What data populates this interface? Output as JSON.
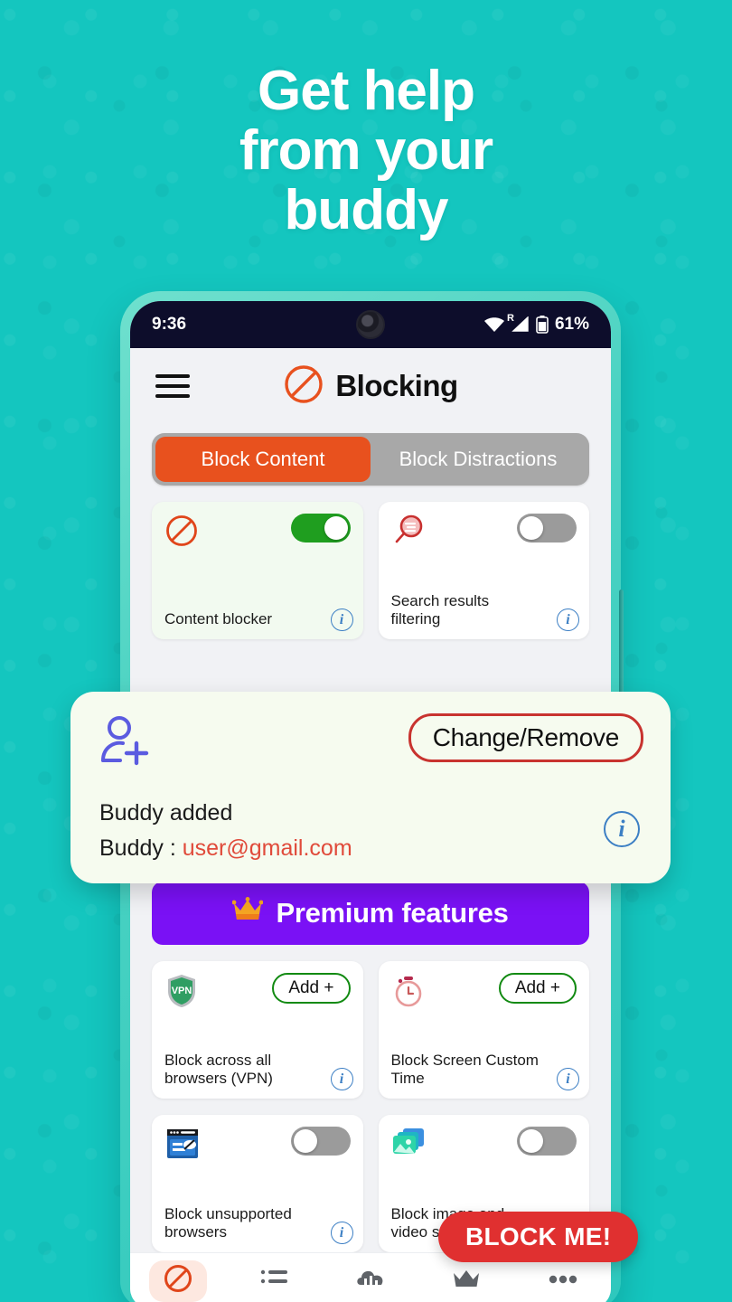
{
  "theme": {
    "background": "#14c6bf",
    "phone_frame": "#4ad2c2",
    "accent_orange": "#e8511e",
    "premium_purple": "#7a11f5",
    "danger_red": "#e03030",
    "toggle_on_green": "#1f9e1f",
    "info_blue": "#3c7fc4",
    "buddy_card_bg": "#f6fbef",
    "email_red": "#e04a3a"
  },
  "headline": {
    "line1": "Get help",
    "line2": "from your",
    "line3": "buddy"
  },
  "status_bar": {
    "time": "9:36",
    "battery_pct": "61%",
    "icons": [
      "wifi-icon",
      "roaming-signal-icon",
      "battery-icon"
    ]
  },
  "app_header": {
    "menu_icon": "hamburger-menu-icon",
    "brand_icon": "no-entry-icon",
    "title": "Blocking"
  },
  "segmented": {
    "tabs": [
      {
        "label": "Block Content",
        "active": true
      },
      {
        "label": "Block Distractions",
        "active": false
      }
    ]
  },
  "feature_cards": [
    {
      "icon": "no-entry-icon",
      "label": "Content blocker",
      "control": "toggle",
      "state": "on",
      "info": "i",
      "tint": "mint"
    },
    {
      "icon": "search-filter-icon",
      "label": "Search results filtering",
      "control": "toggle",
      "state": "off",
      "info": "i",
      "tint": "white"
    }
  ],
  "premium": {
    "icon": "crown-icon",
    "label": "Premium features"
  },
  "premium_cards": [
    {
      "icon": "vpn-shield-icon",
      "label": "Block across all browsers (VPN)",
      "control": "button",
      "button_label": "Add +",
      "info": "i"
    },
    {
      "icon": "timer-clock-icon",
      "label": "Block Screen Custom Time",
      "control": "button",
      "button_label": "Add +",
      "info": "i"
    },
    {
      "icon": "browser-window-icon",
      "label": "Block unsupported browsers",
      "control": "toggle",
      "state": "off",
      "info": "i"
    },
    {
      "icon": "image-stack-icon",
      "label": "Block image and video search",
      "control": "toggle",
      "state": "off",
      "info": "i"
    }
  ],
  "buddy_card": {
    "icon": "person-add-icon",
    "change_button": "Change/Remove",
    "status_line": "Buddy added",
    "buddy_label": "Buddy  :",
    "buddy_email": "user@gmail.com",
    "info": "i"
  },
  "block_me_button": {
    "label": "BLOCK ME!"
  },
  "bottom_nav": {
    "items": [
      {
        "icon": "no-entry-icon",
        "active": true
      },
      {
        "icon": "list-icon",
        "active": false
      },
      {
        "icon": "stats-cloud-icon",
        "active": false
      },
      {
        "icon": "crown-icon",
        "active": false
      },
      {
        "icon": "more-dots-icon",
        "active": false
      }
    ]
  }
}
